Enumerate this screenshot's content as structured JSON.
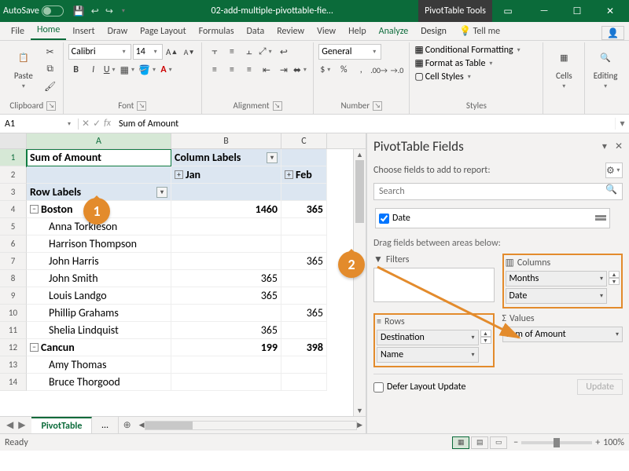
{
  "titlebar": {
    "autosave": "AutoSave",
    "filename": "02-add-multiple-pivottable-fie…",
    "tools": "PivotTable Tools"
  },
  "tabs": {
    "file": "File",
    "home": "Home",
    "insert": "Insert",
    "draw": "Draw",
    "pagelayout": "Page Layout",
    "formulas": "Formulas",
    "data": "Data",
    "review": "Review",
    "view": "View",
    "help": "Help",
    "analyze": "Analyze",
    "design": "Design",
    "tellme": "Tell me"
  },
  "ribbon": {
    "clipboard": {
      "paste": "Paste",
      "label": "Clipboard"
    },
    "font": {
      "name": "Calibri",
      "size": "14",
      "label": "Font"
    },
    "alignment": {
      "label": "Alignment"
    },
    "number": {
      "format": "General",
      "label": "Number"
    },
    "styles": {
      "cf": "Conditional Formatting",
      "fat": "Format as Table",
      "cs": "Cell Styles",
      "label": "Styles"
    },
    "cells": {
      "label": "Cells"
    },
    "editing": {
      "label": "Editing"
    }
  },
  "namebox": "A1",
  "formula": "Sum of Amount",
  "columns": [
    "A",
    "B",
    "C"
  ],
  "pivot": {
    "r1": {
      "a": "Sum of Amount",
      "b": "Column Labels"
    },
    "r2": {
      "b": "Jan",
      "c": "Feb"
    },
    "r3": {
      "a": "Row Labels"
    },
    "r4": {
      "a": "Boston",
      "b": "1460",
      "c": "365"
    },
    "r5": {
      "a": "Anna Torkleson"
    },
    "r6": {
      "a": "Harrison Thompson"
    },
    "r7": {
      "a": "John Harris",
      "c": "365"
    },
    "r8": {
      "a": "John Smith",
      "b": "365"
    },
    "r9": {
      "a": "Louis Landgo",
      "b": "365"
    },
    "r10": {
      "a": "Phillip Grahams",
      "c": "365"
    },
    "r11": {
      "a": "Shelia Lindquist",
      "b": "365"
    },
    "r12": {
      "a": "Cancun",
      "b": "199",
      "c": "398"
    },
    "r13": {
      "a": "Amy Thomas"
    },
    "r14": {
      "a": "Bruce Thorgood"
    }
  },
  "sheet": {
    "active": "PivotTable",
    "more": "…"
  },
  "fieldpane": {
    "title": "PivotTable Fields",
    "subtitle": "Choose fields to add to report:",
    "search_placeholder": "Search",
    "field_date": "Date",
    "drag": "Drag fields between areas below:",
    "filters": "Filters",
    "columns": "Columns",
    "rows": "Rows",
    "values": "Values",
    "col_items": {
      "months": "Months",
      "date": "Date"
    },
    "row_items": {
      "dest": "Destination",
      "name": "Name"
    },
    "val_items": {
      "sum": "Sum of Amount"
    },
    "defer": "Defer Layout Update",
    "update": "Update"
  },
  "status": {
    "ready": "Ready",
    "zoom": "100%"
  },
  "callouts": {
    "one": "1",
    "two": "2"
  }
}
